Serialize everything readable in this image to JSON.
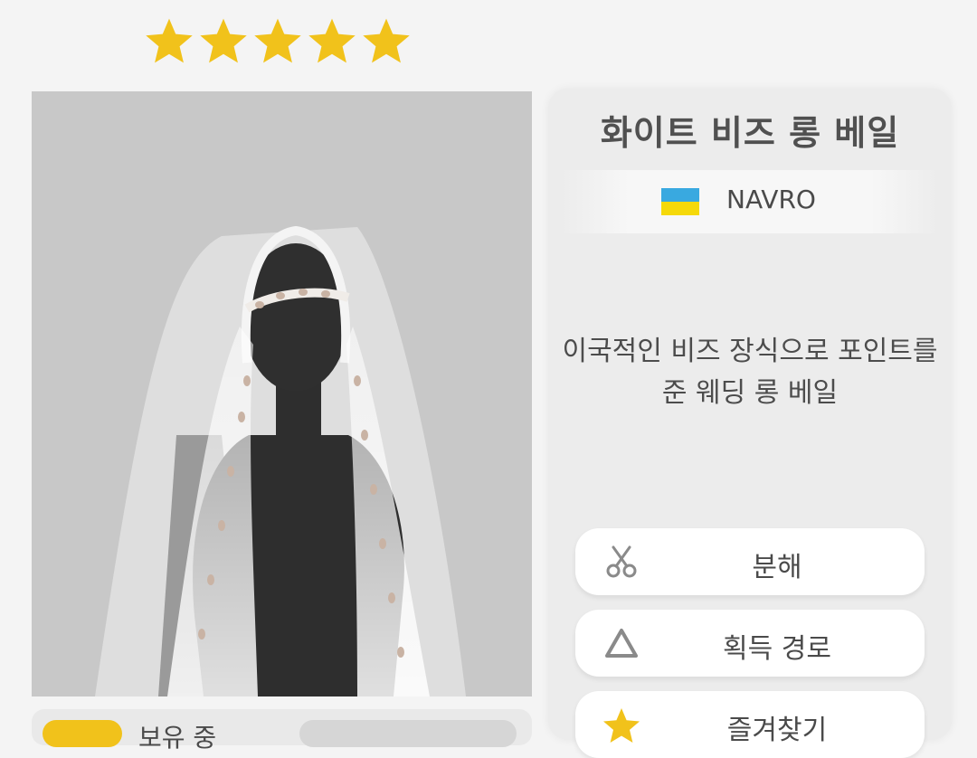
{
  "rating": {
    "stars": 5,
    "max": 5,
    "color": "#f1c21b"
  },
  "item": {
    "name": "화이트 비즈 롱 베일",
    "brand": "NAVRO",
    "brand_flag_colors": [
      "#39a9e0",
      "#f5d90a"
    ],
    "description_lines": [
      "이국적인 비즈 장식으로 포인트를",
      "준 웨딩 롱 베일"
    ]
  },
  "actions": {
    "disassemble": {
      "label": "분해",
      "icon": "scissors-icon"
    },
    "source": {
      "label": "획득 경로",
      "icon": "triangle-icon"
    },
    "favorite": {
      "label": "즐겨찾기",
      "icon": "star-icon"
    }
  },
  "bottom": {
    "owned_label": "보유 중"
  }
}
